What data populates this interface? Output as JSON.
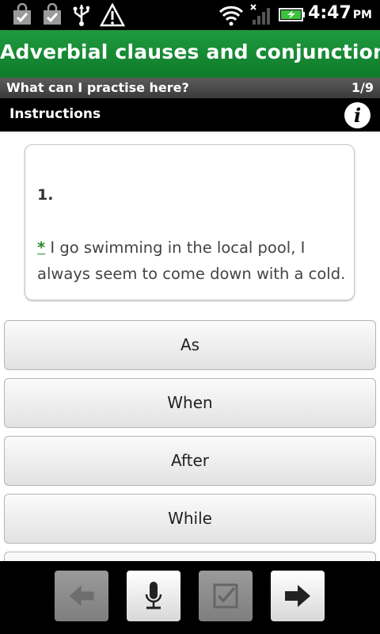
{
  "status_bar": {
    "time": "4:47",
    "ampm": "PM",
    "icons": [
      "shopping-bag-check-icon",
      "shopping-bag-check-icon",
      "usb-icon",
      "warning-icon",
      "wifi-icon",
      "no-signal-icon",
      "battery-charging-icon"
    ]
  },
  "header": {
    "title": "Adverbial clauses and conjunctions"
  },
  "sub_header": {
    "title": "What can I practise here?",
    "progress": "1/9"
  },
  "instructions": {
    "label": "Instructions",
    "info_icon": "i"
  },
  "question": {
    "number": "1.",
    "blank_marker": "*",
    "text": " I go swimming in the local pool, I always seem to come down with a cold."
  },
  "answers": [
    {
      "label": "As"
    },
    {
      "label": "When"
    },
    {
      "label": "After"
    },
    {
      "label": "While"
    }
  ],
  "toolbar": {
    "buttons": [
      {
        "icon": "back-arrow-icon",
        "enabled": false
      },
      {
        "icon": "microphone-icon",
        "enabled": true
      },
      {
        "icon": "checkbox-icon",
        "enabled": false
      },
      {
        "icon": "forward-arrow-icon",
        "enabled": true
      }
    ]
  },
  "colors": {
    "header_green": "#178a34",
    "blank_green": "#2a8a2a"
  }
}
